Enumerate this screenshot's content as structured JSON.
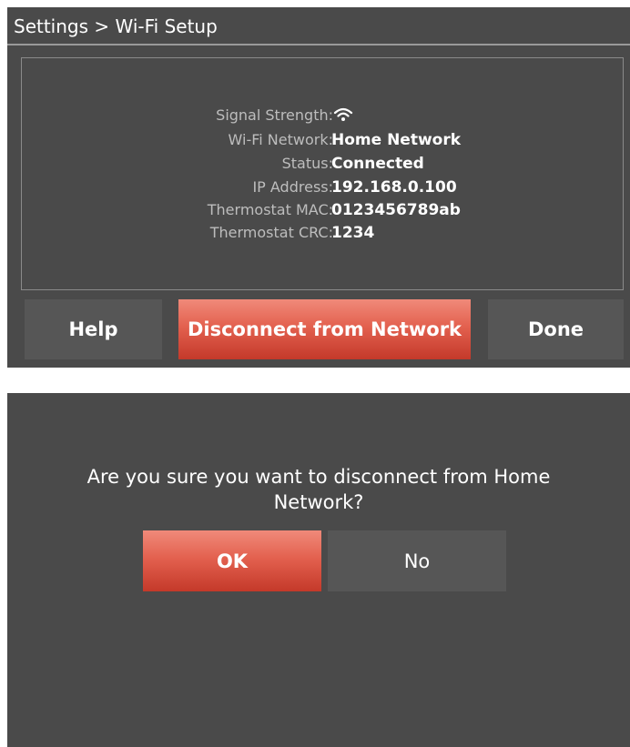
{
  "screen_setup": {
    "breadcrumb": "Settings > Wi-Fi Setup",
    "info": {
      "signal_strength_label": "Signal Strength:",
      "signal_strength_icon": "wifi-signal-icon",
      "network_label": "Wi-Fi Network:",
      "network_value": "Home Network",
      "status_label": "Status:",
      "status_value": "Connected",
      "ip_label": "IP Address:",
      "ip_value": "192.168.0.100",
      "mac_label": "Thermostat MAC:",
      "mac_value": "0123456789ab",
      "crc_label": "Thermostat CRC:",
      "crc_value": "1234"
    },
    "buttons": {
      "help": "Help",
      "disconnect": "Disconnect from Network",
      "done": "Done"
    }
  },
  "screen_confirm": {
    "message": "Are you sure you want to disconnect from Home Network?",
    "buttons": {
      "ok": "OK",
      "no": "No"
    }
  },
  "colors": {
    "screen_background": "#4a4a4a",
    "button_gray": "#565656",
    "button_red": "#e3614f",
    "label_gray": "#bdbdbd",
    "text_white": "#ffffff"
  }
}
